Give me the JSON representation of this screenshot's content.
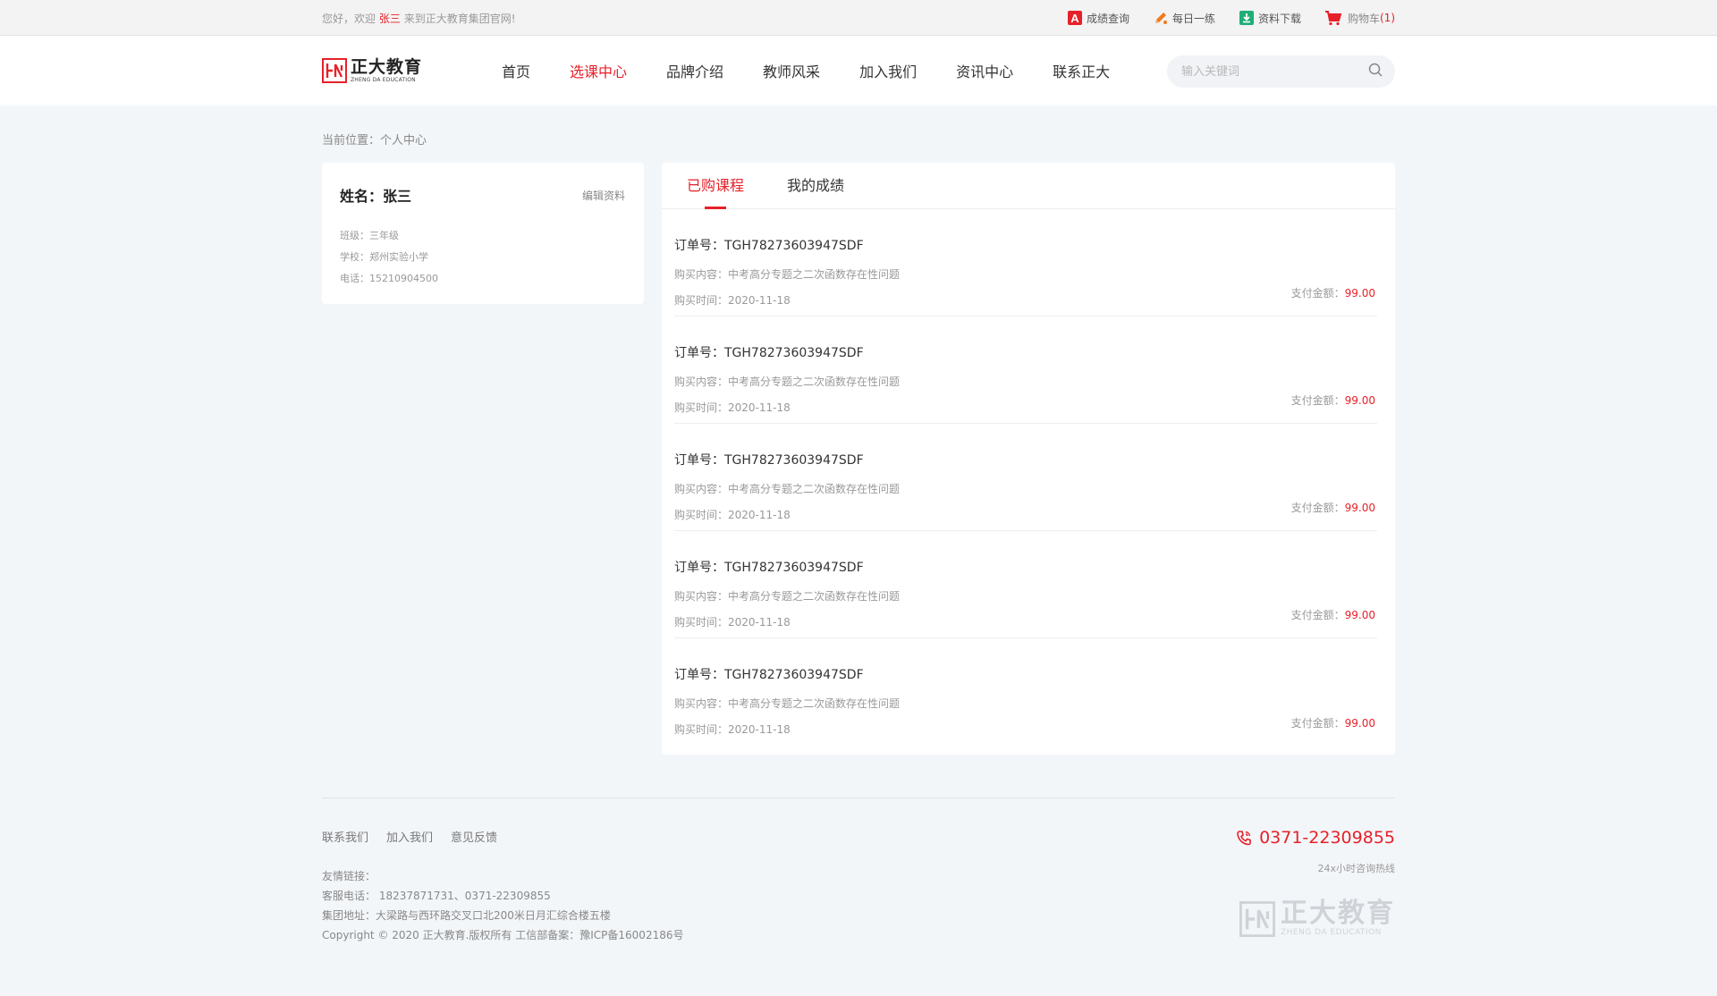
{
  "topbar": {
    "welcome_prefix": "您好，欢迎",
    "username": "张三",
    "welcome_suffix": "来到正大教育集团官网!",
    "links": {
      "score": "成绩查询",
      "daily": "每日一练",
      "download": "资料下载",
      "cart": "购物车",
      "cart_count": "(1)"
    }
  },
  "header": {
    "logo_cn": "正大教育",
    "logo_en": "ZHENG DA EDUCATION",
    "nav": [
      "首页",
      "选课中心",
      "品牌介绍",
      "教师风采",
      "加入我们",
      "资讯中心",
      "联系正大"
    ],
    "active_nav": "选课中心",
    "search_placeholder": "输入关键词"
  },
  "breadcrumb": "当前位置：个人中心",
  "profile": {
    "name": "姓名：张三",
    "edit_label": "编辑资料",
    "class": "班级：三年级",
    "school": "学校：郑州实验小学",
    "phone": "电话：15210904500"
  },
  "orders": {
    "tabs": [
      "已购课程",
      "我的成绩"
    ],
    "items": [
      {
        "no": "订单号：TGH78273603947SDF",
        "content": "购买内容：中考高分专题之二次函数存在性问题",
        "time": "购买时间：2020-11-18",
        "pay_label": "支付金额：",
        "amount": "99.00"
      },
      {
        "no": "订单号：TGH78273603947SDF",
        "content": "购买内容：中考高分专题之二次函数存在性问题",
        "time": "购买时间：2020-11-18",
        "pay_label": "支付金额：",
        "amount": "99.00"
      },
      {
        "no": "订单号：TGH78273603947SDF",
        "content": "购买内容：中考高分专题之二次函数存在性问题",
        "time": "购买时间：2020-11-18",
        "pay_label": "支付金额：",
        "amount": "99.00"
      },
      {
        "no": "订单号：TGH78273603947SDF",
        "content": "购买内容：中考高分专题之二次函数存在性问题",
        "time": "购买时间：2020-11-18",
        "pay_label": "支付金额：",
        "amount": "99.00"
      },
      {
        "no": "订单号：TGH78273603947SDF",
        "content": "购买内容：中考高分专题之二次函数存在性问题",
        "time": "购买时间：2020-11-18",
        "pay_label": "支付金额：",
        "amount": "99.00"
      }
    ]
  },
  "footer": {
    "links": [
      "联系我们",
      "加入我们",
      "意见反馈"
    ],
    "friend_links": "友情链接：",
    "service_phone": "客服电话：  18237871731、0371-22309855",
    "address": "集团地址：大梁路与西环路交叉口北200米日月汇综合楼五楼",
    "copyright": "Copyright ©  2020 正大教育.版权所有 工信部备案：豫ICP备16002186号",
    "hotline": "0371-22309855",
    "hotline_label": "24x小时咨询热线",
    "logo_cn": "正大教育",
    "logo_en": "ZHENG DA EDUCATION"
  },
  "colors": {
    "accent": "#e62129",
    "background": "#f3f6f9"
  }
}
